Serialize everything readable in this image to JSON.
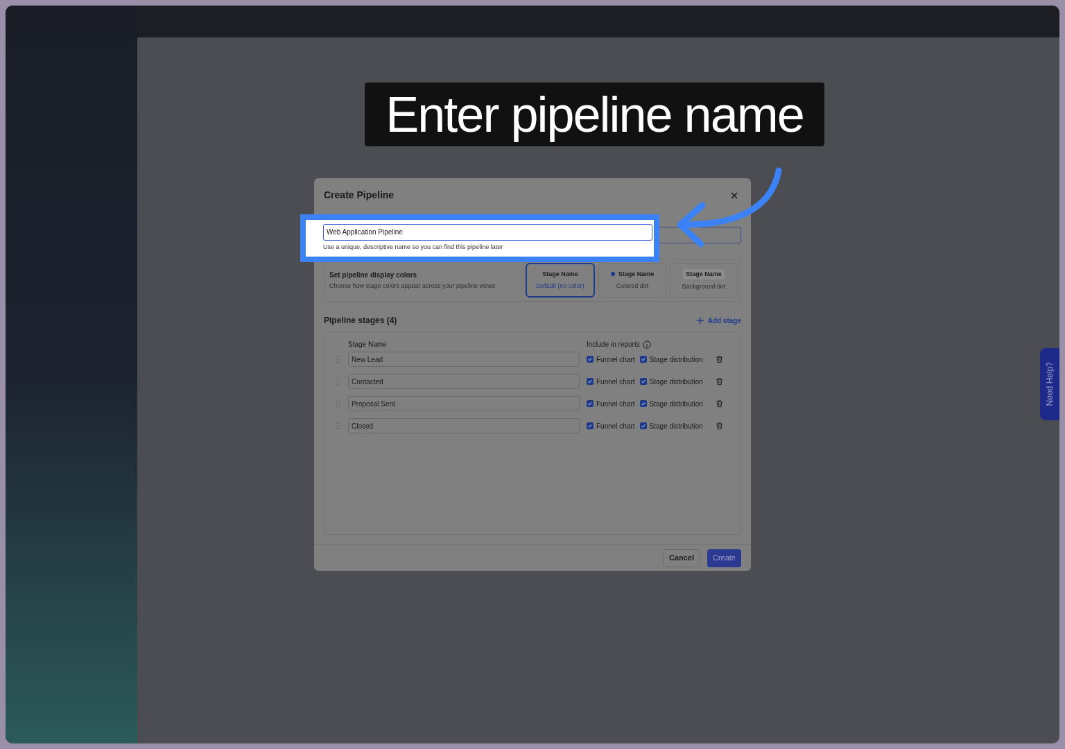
{
  "callout": {
    "text": "Enter pipeline name"
  },
  "dialog": {
    "title": "Create Pipeline",
    "name_field": {
      "value": "Web Application Pipeline",
      "hint": "Use a unique, descriptive name so you can find this pipeline later"
    },
    "display_colors": {
      "title": "Set pipeline display colors",
      "subtitle": "Choose how stage colors appear across your pipeline views",
      "options": [
        {
          "kind": "default",
          "label": "Stage Name",
          "caption": "Default (no color)",
          "selected": true
        },
        {
          "kind": "dot",
          "label": "Stage Name",
          "caption": "Colored dot",
          "selected": false
        },
        {
          "kind": "tint",
          "label": "Stage Name",
          "caption": "Background tint",
          "selected": false
        }
      ]
    },
    "stages_title": "Pipeline stages (4)",
    "add_stage": "Add stage",
    "columns": [
      "Stage Name",
      "Include in reports"
    ],
    "stages": [
      {
        "name": "New Lead",
        "funnel": {
          "label": "Funnel chart",
          "checked": true
        },
        "distribution": {
          "label": "Stage distribution",
          "checked": true
        }
      },
      {
        "name": "Contacted",
        "funnel": {
          "label": "Funnel chart",
          "checked": true
        },
        "distribution": {
          "label": "Stage distribution",
          "checked": true
        }
      },
      {
        "name": "Proposal Sent",
        "funnel": {
          "label": "Funnel chart",
          "checked": true
        },
        "distribution": {
          "label": "Stage distribution",
          "checked": true
        }
      },
      {
        "name": "Closed",
        "funnel": {
          "label": "Funnel chart",
          "checked": true
        },
        "distribution": {
          "label": "Stage distribution",
          "checked": true
        }
      }
    ],
    "buttons": {
      "cancel": "Cancel",
      "create": "Create"
    }
  },
  "help_tab": "Need Help?"
}
